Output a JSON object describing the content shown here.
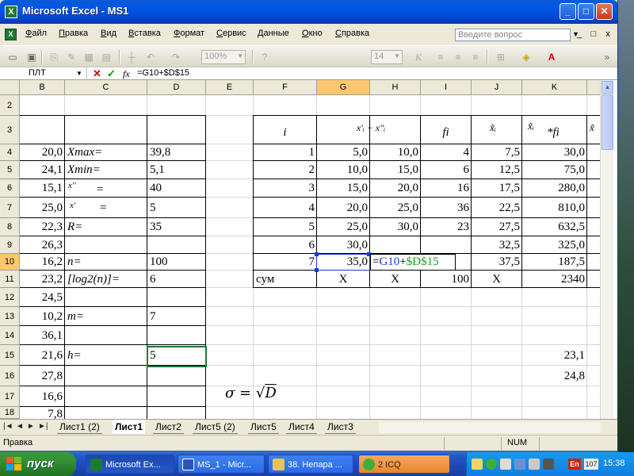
{
  "window": {
    "title": "Microsoft Excel - MS1",
    "app_icon": "X",
    "min_label": "_",
    "max_label": "□",
    "close_label": "✕"
  },
  "menu": {
    "items": [
      "Файл",
      "Правка",
      "Вид",
      "Вставка",
      "Формат",
      "Сервис",
      "Данные",
      "Окно",
      "Справка"
    ],
    "help_placeholder": "Введите вопрос",
    "doc_min": "_",
    "doc_restore": "□",
    "doc_close": "x"
  },
  "toolbar": {
    "zoom": "100%",
    "font_size": "14"
  },
  "formula_bar": {
    "name_box": "ПЛТ",
    "cancel": "✕",
    "enter": "✓",
    "fx": "fx",
    "formula": "=G10+$D$15"
  },
  "columns": [
    "B",
    "C",
    "D",
    "E",
    "F",
    "G",
    "H",
    "I",
    "J",
    "K"
  ],
  "rows": [
    "2",
    "3",
    "4",
    "5",
    "6",
    "7",
    "8",
    "9",
    "10",
    "11",
    "12",
    "13",
    "14",
    "15",
    "16",
    "17",
    "18"
  ],
  "cells": {
    "B4": "20,0",
    "B5": "24,1",
    "B6": "15,1",
    "B7": "25,0",
    "B8": "22,3",
    "B9": "26,3",
    "B10": "16,2",
    "B11": "23,2",
    "B12": "24,5",
    "B13": "10,2",
    "B14": "36,1",
    "B15": "21,6",
    "B16": "27,8",
    "B17": "16,6",
    "B18": "7,8",
    "C4": "Xmax=",
    "C5": "Xmin=",
    "C6": "x''",
    "C6b": "=",
    "C7": "x'",
    "C7b": "=",
    "C8": "R=",
    "C10": "n=",
    "C11": "[log2(n)]=",
    "C13": "m=",
    "C15": "h=",
    "D4": "39,8",
    "D5": "5,1",
    "D6": "40",
    "D7": "5",
    "D8": "35",
    "D10": "100",
    "D11": "6",
    "D13": "7",
    "D15": "5",
    "F3": "i",
    "G3": "x'ᵢ − x''ᵢ",
    "I3": "fi",
    "J3": "x̃ᵢ",
    "K3a": "x̃ᵢ",
    "K3b": "*fi",
    "L3": "x̃",
    "F4": "1",
    "G4": "5,0",
    "H4": "10,0",
    "I4": "4",
    "J4": "7,5",
    "K4": "30,0",
    "F5": "2",
    "G5": "10,0",
    "H5": "15,0",
    "I5": "6",
    "J5": "12,5",
    "K5": "75,0",
    "F6": "3",
    "G6": "15,0",
    "H6": "20,0",
    "I6": "16",
    "J6": "17,5",
    "K6": "280,0",
    "F7": "4",
    "G7": "20,0",
    "H7": "25,0",
    "I7": "36",
    "J7": "22,5",
    "K7": "810,0",
    "F8": "5",
    "G8": "25,0",
    "H8": "30,0",
    "I8": "23",
    "J8": "27,5",
    "K8": "632,5",
    "F9": "6",
    "G9": "30,0",
    "J9": "32,5",
    "K9": "325,0",
    "F10": "7",
    "G10": "35,0",
    "J10": "37,5",
    "K10": "187,5",
    "E11": "сум",
    "G11": "X",
    "H11": "X",
    "I11": "100",
    "J11": "X",
    "K11": "2340",
    "K15": "23,1",
    "K16": "24,8"
  },
  "editing": {
    "prefix": "=",
    "ref1": "G10",
    "op": "+",
    "ref2": "$D$15"
  },
  "sigma_formula": {
    "lhs": "σ",
    "eq": "=",
    "radical": "√",
    "arg": "D"
  },
  "sheet_tabs": [
    "Лист1 (2)",
    "Лист1",
    "Лист2",
    "Лист5 (2)",
    "Лист5",
    "Лист4",
    "Лист3"
  ],
  "active_tab": "Лист1",
  "nav_buttons": [
    "|◄",
    "◄",
    "►",
    "►|"
  ],
  "status": {
    "mode": "Правка",
    "num": "NUM"
  },
  "taskbar": {
    "start": "пуск",
    "buttons": [
      "Microsoft Ex...",
      "MS_1 - Micr...",
      "38. Непара ...",
      "2 ICQ"
    ],
    "lang": "En",
    "lang_num": "107",
    "clock": "15:38"
  },
  "colors": {
    "ref_blue": "#1a3bd6",
    "ref_green": "#1d9a1d",
    "header_selected": "#ffc86e"
  }
}
